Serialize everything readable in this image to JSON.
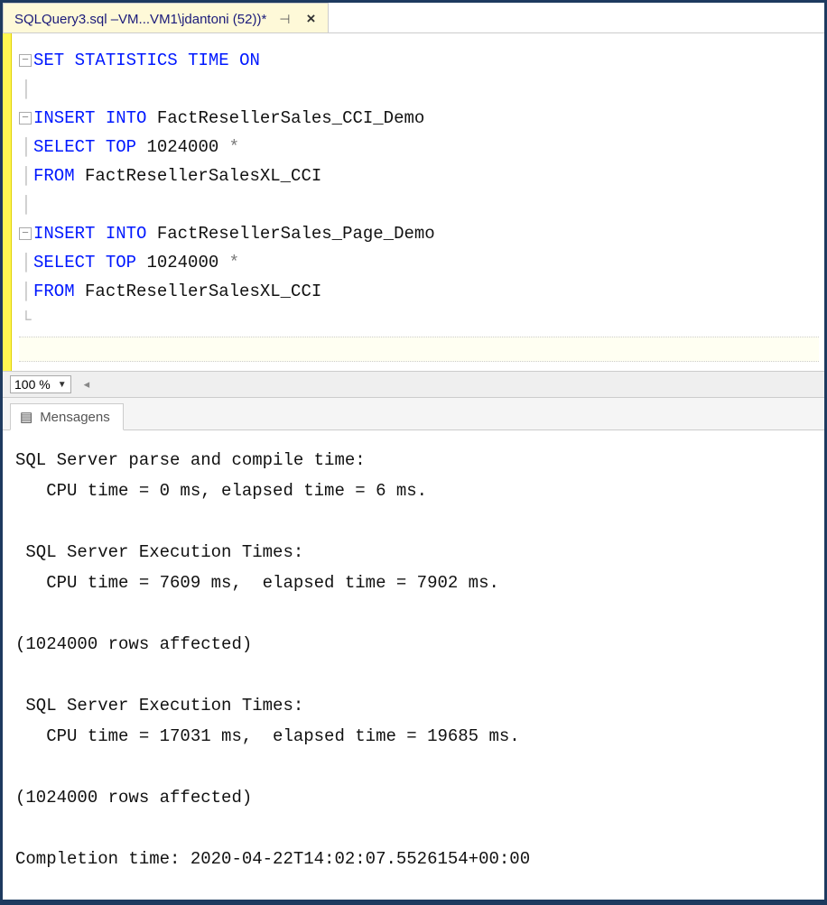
{
  "tab": {
    "title": "SQLQuery3.sql –VM...VM1\\jdantoni (52))*"
  },
  "editor": {
    "lines": [
      {
        "fold": true,
        "tokens": [
          {
            "t": "SET",
            "c": "kw"
          },
          {
            "t": " ",
            "c": "txt"
          },
          {
            "t": "STATISTICS",
            "c": "kw"
          },
          {
            "t": " ",
            "c": "txt"
          },
          {
            "t": "TIME",
            "c": "kw"
          },
          {
            "t": " ",
            "c": "txt"
          },
          {
            "t": "ON",
            "c": "kw"
          }
        ]
      },
      {
        "blank": true
      },
      {
        "fold": true,
        "tokens": [
          {
            "t": "INSERT",
            "c": "kw"
          },
          {
            "t": " ",
            "c": "txt"
          },
          {
            "t": "INTO",
            "c": "kw"
          },
          {
            "t": " FactResellerSales_CCI_Demo",
            "c": "txt"
          }
        ]
      },
      {
        "tokens": [
          {
            "t": "SELECT",
            "c": "kw"
          },
          {
            "t": " ",
            "c": "txt"
          },
          {
            "t": "TOP",
            "c": "kw"
          },
          {
            "t": " 1024000 ",
            "c": "txt"
          },
          {
            "t": "*",
            "c": "star"
          }
        ]
      },
      {
        "tokens": [
          {
            "t": "FROM",
            "c": "kw"
          },
          {
            "t": " FactResellerSalesXL_CCI",
            "c": "txt"
          }
        ]
      },
      {
        "blank": true
      },
      {
        "fold": true,
        "tokens": [
          {
            "t": "INSERT",
            "c": "kw"
          },
          {
            "t": " ",
            "c": "txt"
          },
          {
            "t": "INTO",
            "c": "kw"
          },
          {
            "t": " FactResellerSales_Page_Demo",
            "c": "txt"
          }
        ]
      },
      {
        "tokens": [
          {
            "t": "SELECT",
            "c": "kw"
          },
          {
            "t": " ",
            "c": "txt"
          },
          {
            "t": "TOP",
            "c": "kw"
          },
          {
            "t": " 1024000 ",
            "c": "txt"
          },
          {
            "t": "*",
            "c": "star"
          }
        ]
      },
      {
        "tokens": [
          {
            "t": "FROM",
            "c": "kw"
          },
          {
            "t": " FactResellerSalesXL_CCI",
            "c": "txt"
          }
        ]
      }
    ]
  },
  "zoom": {
    "value": "100 %"
  },
  "results": {
    "tab_label": "Mensagens",
    "messages": "SQL Server parse and compile time: \n   CPU time = 0 ms, elapsed time = 6 ms.\n\n SQL Server Execution Times:\n   CPU time = 7609 ms,  elapsed time = 7902 ms.\n\n(1024000 rows affected)\n\n SQL Server Execution Times:\n   CPU time = 17031 ms,  elapsed time = 19685 ms.\n\n(1024000 rows affected)\n\nCompletion time: 2020-04-22T14:02:07.5526154+00:00"
  }
}
